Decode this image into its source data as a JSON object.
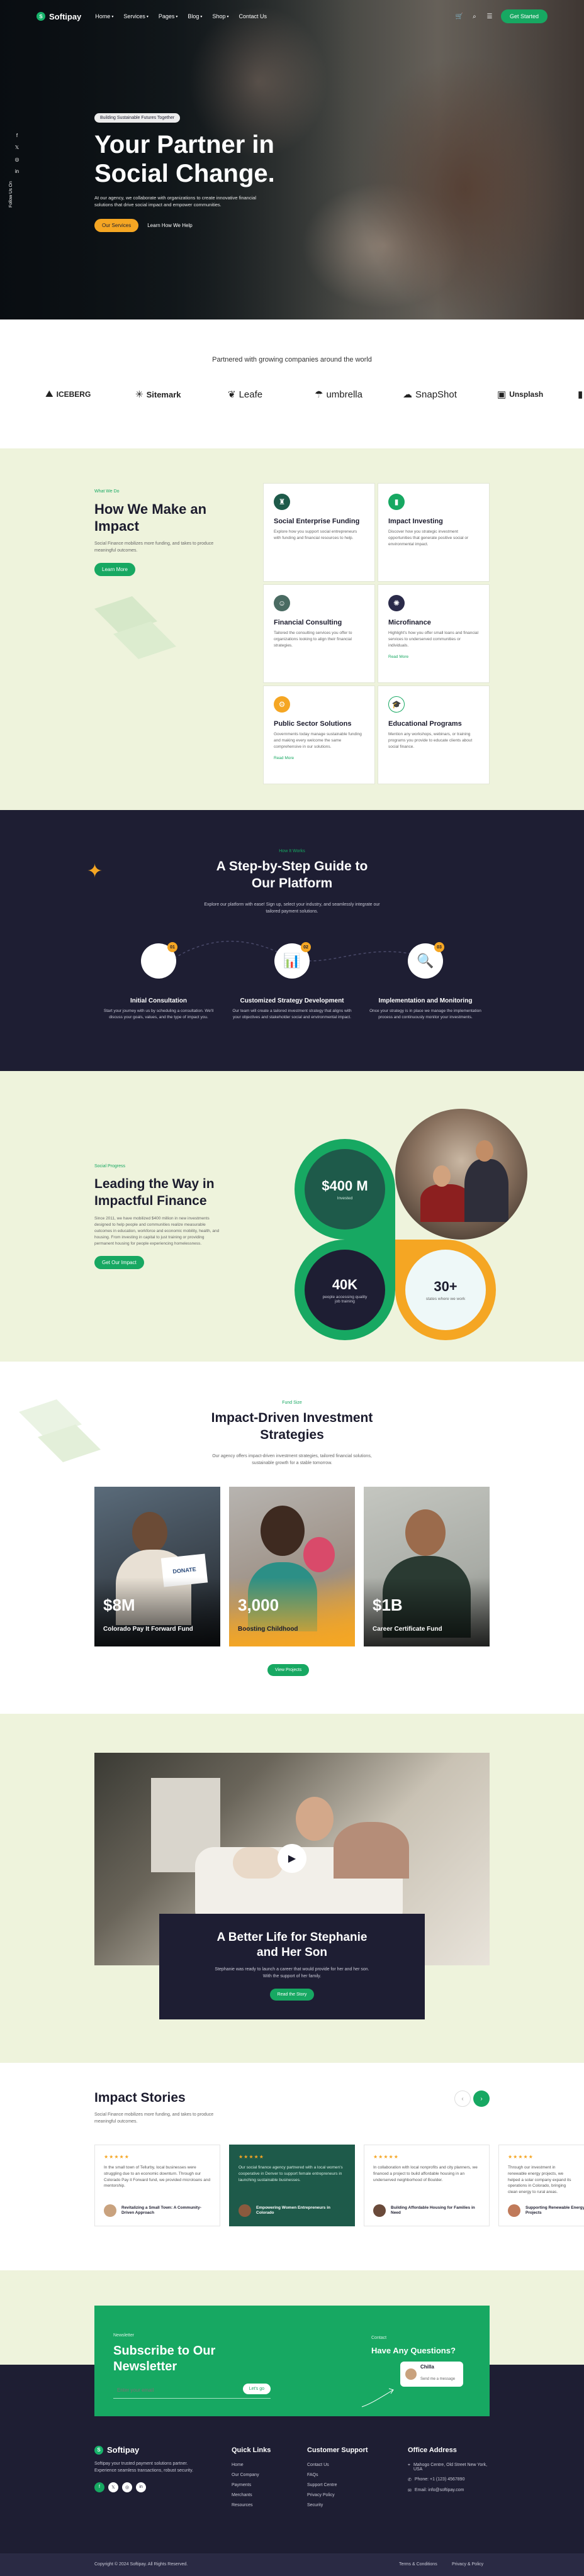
{
  "nav": {
    "brand": "Softipay",
    "menu": [
      "Home",
      "Services",
      "Pages",
      "Blog",
      "Shop",
      "Contact Us"
    ],
    "cta": "Get Started"
  },
  "hero": {
    "tag": "Building Sustainable Futures Together",
    "title_line1": "Your Partner in",
    "title_line2": "Social Change.",
    "desc": "At our agency, we collaborate with organizations to create innovative financial solutions that drive social impact and empower communities.",
    "btn_primary": "Our Services",
    "btn_secondary": "Learn How We Help",
    "follow": "Follow Us On"
  },
  "partners": {
    "title": "Partnered with growing companies around the world",
    "logos": [
      "ICEBERG",
      "Sitemark",
      "Leafe",
      "umbrella",
      "SnapShot",
      "Unsplash"
    ]
  },
  "impact": {
    "label": "What We Do",
    "title_line1": "How We Make an",
    "title_line2": "Impact",
    "desc": "Social Finance mobilizes more funding, and takes to produce meaningful outcomes.",
    "btn": "Learn More",
    "cards": [
      {
        "title": "Social Enterprise Funding",
        "desc": "Explore how you support social entrepreneurs with funding and financial resources to help.",
        "link": ""
      },
      {
        "title": "Impact Investing",
        "desc": "Discover how you strategic investment opportunities that generate positive social or environmental impact.",
        "link": ""
      },
      {
        "title": "Financial Consulting",
        "desc": "Tailored the consulting services you offer to organizations looking to align their financial strategies.",
        "link": ""
      },
      {
        "title": "Microfinance",
        "desc": "Highlight's how you offer small loans and financial services to underserved communities or individuals.",
        "link": "Read More"
      },
      {
        "title": "Public Sector Solutions",
        "desc": "Governments today manage sustainable funding and making every welcome the same comprehensive in our solutions.",
        "link": "Read More"
      },
      {
        "title": "Educational Programs",
        "desc": "Mention any workshops, webinars, or training programs you provide to educate clients about social finance.",
        "link": ""
      }
    ]
  },
  "steps": {
    "label": "How It Works",
    "title_line1": "A Step-by-Step Guide to",
    "title_line2": "Our Platform",
    "desc": "Explore our platform with ease! Sign up, select your industry, and seamlessly integrate our tailored payment solutions.",
    "items": [
      {
        "num": "01",
        "title": "Initial Consultation",
        "desc": "Start your journey with us by scheduling a consultation. We'll discuss your goals, values, and the type of impact you."
      },
      {
        "num": "02",
        "title": "Customized Strategy Development",
        "desc": "Our team will create a tailored investment strategy that aligns with your objectives and stakeholder social and environmental impact."
      },
      {
        "num": "03",
        "title": "Implementation and Monitoring",
        "desc": "Once your strategy is in place we manage the implementation process and continuously monitor your investments."
      }
    ]
  },
  "leading": {
    "label": "Social Progress",
    "title_line1": "Leading the Way in",
    "title_line2": "Impactful Finance",
    "desc": "Since 2011, we have mobilized $400 million in new investments designed to help people and communities realize measurable outcomes in education, workforce and economic mobility, health, and housing. From investing in capital to just training or providing permanent housing for people experiencing homelessness.",
    "btn": "Get Our Impact",
    "stat1_value": "$400 M",
    "stat1_label": "Invested",
    "stat2_value": "40K",
    "stat2_label": "people accessing quality job training",
    "stat3_value": "30+",
    "stat3_label": "states where we work"
  },
  "strategies": {
    "label": "Fund Size",
    "title_line1": "Impact-Driven Investment",
    "title_line2": "Strategies",
    "desc": "Our agency offers impact-driven investment strategies, tailored financial solutions, sustainable growth for a stable tomorrow.",
    "cards": [
      {
        "value": "$8M",
        "label": "Colorado Pay It Forward Fund",
        "sign": "DONATE"
      },
      {
        "value": "3,000",
        "label": "Boosting Childhood",
        "sub": ""
      },
      {
        "value": "$1B",
        "label": "Career Certificate Fund"
      }
    ],
    "btn": "View Projects"
  },
  "story": {
    "title_line1": "A Better Life for Stephanie",
    "title_line2": "and Her Son",
    "desc": "Stephanie was ready to launch a career that would provide for her and her son. With the support of her family.",
    "btn": "Read the Story"
  },
  "istories": {
    "title": "Impact Stories",
    "desc": "Social Finance mobilizes more funding, and takes to produce meaningful outcomes.",
    "cards": [
      {
        "stars": "★★★★★",
        "text": "In the small town of Tellurby, local businesses were struggling due to an economic downturn. Through our Colorado Pay it Forward fund, we provided microloans and mentorship.",
        "name": "Revitalizing a Small Town: A Community-Driven Approach"
      },
      {
        "stars": "★★★★★",
        "text": "Our social finance agency partnered with a local women's cooperative in Denver to support female entrepreneurs in launching sustainable businesses.",
        "name": "Empowering Women Entrepreneurs in Colorado"
      },
      {
        "stars": "★★★★★",
        "text": "In collaboration with local nonprofits and city planners, we financed a project to build affordable housing in an underserved neighborhood of Boulder.",
        "name": "Building Affordable Housing for Families in Need"
      },
      {
        "stars": "★★★★★",
        "text": "Through our investment in renewable energy projects, we helped a solar company expand its operations in Colorado, bringing clean energy to rural areas.",
        "name": "Supporting Renewable Energy Projects"
      }
    ]
  },
  "newsletter": {
    "label": "Newsletter",
    "title_line1": "Subscribe to Our",
    "title_line2": "Newsletter",
    "placeholder": "Enter your email",
    "btn": "Let's go",
    "contact_label": "Contact",
    "contact_title": "Have Any Questions?",
    "contact_name": "Chilla",
    "contact_sub": "Send me a message"
  },
  "footer": {
    "brand": "Softipay",
    "about": "Softipay your trusted payment solutions partner. Experience seamless transactions, robust security.",
    "quick_title": "Quick Links",
    "quick": [
      "Home",
      "Our Company",
      "Payments",
      "Merchants",
      "Resources"
    ],
    "support_title": "Customer Support",
    "support": [
      "Contact Us",
      "FAQs",
      "Support Centre",
      "Privacy Policy",
      "Security"
    ],
    "office_title": "Office Address",
    "office": [
      "Mahogo Centre, Old Street New York, USA",
      "Phone: +1 (123) 4567890",
      "Email: info@softipay.com"
    ],
    "copyright": "Copyright © 2024 Softipay. All Rights Reserved.",
    "legal": [
      "Terms & Conditions",
      "Privacy & Policy"
    ]
  },
  "colors": {
    "green": "#17a862",
    "navy": "#1e1e33",
    "cream": "#eef3dc",
    "orange": "#f5a623"
  }
}
